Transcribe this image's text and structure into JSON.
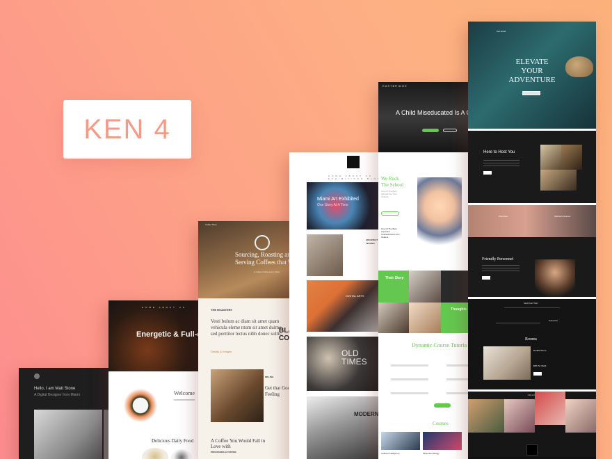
{
  "badge": {
    "text": "KEN 4"
  },
  "portfolio": {
    "greeting": "Hello, I am Matt Stone",
    "tagline": "A Digital Designer from Miami"
  },
  "restaurant": {
    "nav": "HOME ABOUT US",
    "hero_title": "Energetic & Full-calo",
    "welcome": "Welcome",
    "daily_food": "Delicious Daily Food"
  },
  "coffee": {
    "top_bar": "Coffee Shop",
    "hero_title": "Sourcing, Roasting an\nServing Coffees that We L",
    "hero_sub": "A Coffee Unlike Every Other",
    "roastery": "THE ROASTERY",
    "paragraph": "Vesti bulum ac diam sit amet quam vehicula eleme ntum sit amet duimo sed porttitor lectus nibh donec sollic.",
    "link": "Details & Images",
    "black_word": "BLA\nCOF",
    "milling": "MILLING",
    "feeling": "Get that Goo\nFeeling",
    "cup": "A Coffee You Would Fall in\nLove with",
    "process": "PROCESSING & TESTING"
  },
  "gallery": {
    "nav": "HOME ABOUT US EXHIBITIONS BLOG",
    "miami": "Miami Art Exhibited",
    "miami_sub": "One Story At A Time",
    "arch": "ARCHITECT\nTECHNO",
    "digital": "DIGITAL ARTS",
    "old_times": "OLD\nTIMES",
    "modern": "MODERN"
  },
  "school": {
    "brand": "EASTBRIDGE",
    "hero_title": "A Child Miseducated Is A Ch",
    "rock": "We Rock\nThe School",
    "rock_text": "One Of The Best Schools For Your Children",
    "the_one": "One Of The Best Important Characteristics Of A Student",
    "their_story": "Their Story",
    "thoughts": "Thoughts",
    "dynamic": "Dynamic Course Tutoria",
    "courses": "Courses",
    "course1": "Artificial Intelligence",
    "course2": "Molecular Biology"
  },
  "hotel": {
    "brand": "Ken Hotel",
    "elevate": "ELEVATE\nYOUR\nADVENTURE",
    "host": "Here to Host You",
    "pool_a": "Pool Area",
    "pool_b": "Wellness Heaven",
    "friendly": "Friendly Personnel",
    "newsletter": "NEWSLETTER",
    "subscribe": "Subscribe",
    "rooms": "Rooms",
    "double_room": "Double Room",
    "per_night": "$95 Per Night",
    "follow": "FOLLOW US ON"
  },
  "colors": {
    "bg_start": "#fd8d8f",
    "bg_end": "#fcb17b",
    "badge_text": "#f59a86",
    "school_green": "#64c850"
  }
}
